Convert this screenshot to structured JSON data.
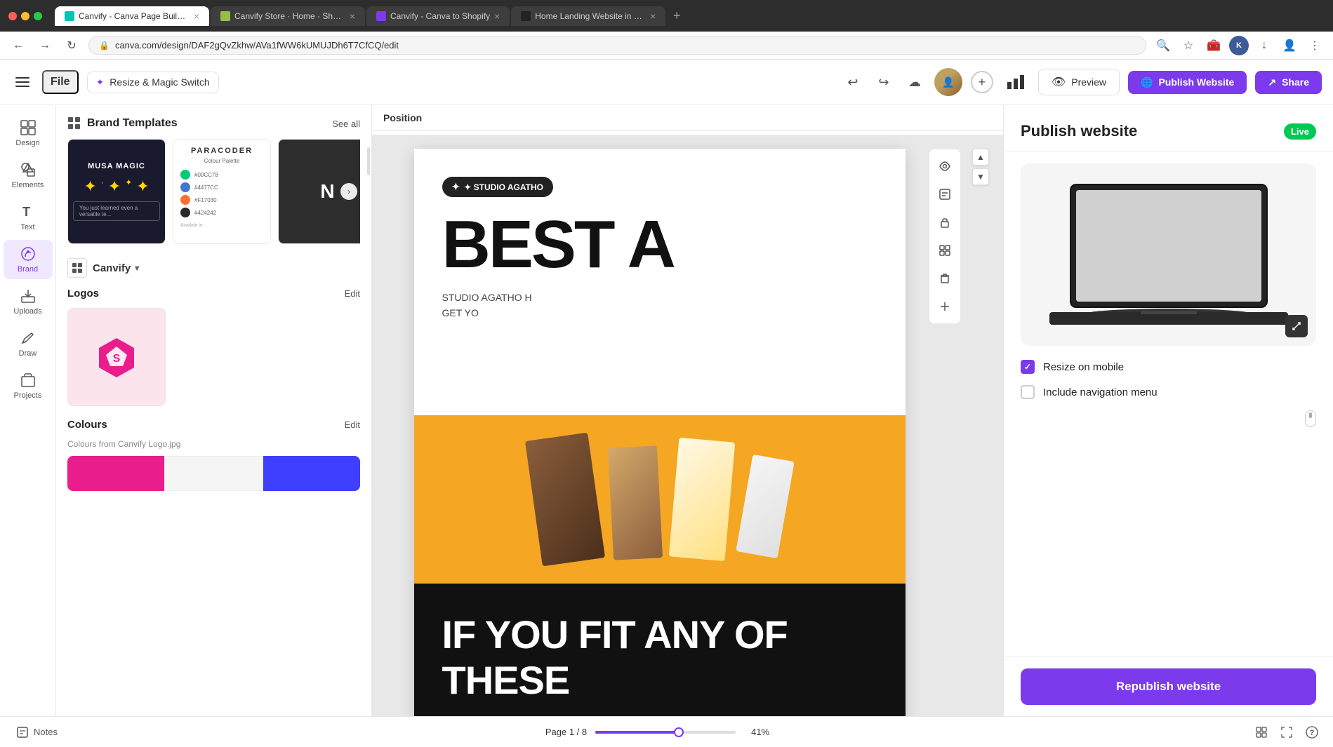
{
  "browser": {
    "tabs": [
      {
        "id": "tab1",
        "title": "Canvify - Canva Page Builder -",
        "icon_type": "canva-green",
        "active": true,
        "closeable": true
      },
      {
        "id": "tab2",
        "title": "Canvify Store · Home · Shopify",
        "icon_type": "shopify-green",
        "active": false,
        "closeable": true
      },
      {
        "id": "tab3",
        "title": "Canvify - Canva to Shopify",
        "icon_type": "canva-blue",
        "active": false,
        "closeable": true
      },
      {
        "id": "tab4",
        "title": "Home Landing Website in Blac...",
        "icon_type": "home-black",
        "active": false,
        "closeable": true
      }
    ],
    "url": "canva.com/design/DAF2gQvZkhw/AVa1fWW6kUMUJDh6T7CfCQ/edit",
    "new_tab_label": "+"
  },
  "toolbar": {
    "file_label": "File",
    "magic_switch_label": "Resize & Magic Switch",
    "undo_label": "↩",
    "redo_label": "↪",
    "preview_label": "Preview",
    "publish_label": "Publish Website",
    "share_label": "Share"
  },
  "sidebar": {
    "items": [
      {
        "id": "design",
        "label": "Design",
        "icon": "design"
      },
      {
        "id": "elements",
        "label": "Elements",
        "icon": "elements"
      },
      {
        "id": "text",
        "label": "Text",
        "icon": "text"
      },
      {
        "id": "brand",
        "label": "Brand",
        "icon": "brand",
        "active": true
      },
      {
        "id": "uploads",
        "label": "Uploads",
        "icon": "uploads"
      },
      {
        "id": "draw",
        "label": "Draw",
        "icon": "draw"
      },
      {
        "id": "projects",
        "label": "Projects",
        "icon": "projects"
      }
    ]
  },
  "left_panel": {
    "brand_templates_title": "Brand Templates",
    "see_all_label": "See all",
    "templates": [
      {
        "id": "t1",
        "type": "musa",
        "title": "MUSA MAGIC"
      },
      {
        "id": "t2",
        "type": "paracoder",
        "title": "PARACODER"
      },
      {
        "id": "t3",
        "type": "n",
        "title": "N"
      }
    ],
    "brand_name": "Canvify",
    "logos_label": "Logos",
    "logos_edit_label": "Edit",
    "colours_label": "Colours",
    "colours_edit_label": "Edit",
    "colours_from_label": "Colours from Canvify Logo.jpg",
    "colour_swatches": [
      {
        "color": "#e91e8c"
      },
      {
        "color": "#f5f5f5"
      },
      {
        "color": "#3f3fff"
      }
    ]
  },
  "canvas": {
    "position_label": "Position",
    "page_indicator": "Page 1 / 8",
    "zoom_percent": "41%",
    "studio_badge": "✦ STUDIO AGATHO",
    "best_a_text": "BEST A",
    "studio_sub1": "STUDIO AGATHO H",
    "studio_sub2": "GET YO",
    "canvas_text_big": "IF YOU FIT ANY OF THESE"
  },
  "publish_panel": {
    "title": "Publish website",
    "live_label": "Live",
    "resize_mobile_label": "Resize on mobile",
    "resize_mobile_checked": true,
    "nav_menu_label": "Include navigation menu",
    "nav_menu_checked": false,
    "republish_label": "Republish website"
  },
  "bottom_bar": {
    "notes_label": "Notes",
    "page_indicator": "Page 1 / 8",
    "zoom_percent": "41%"
  }
}
